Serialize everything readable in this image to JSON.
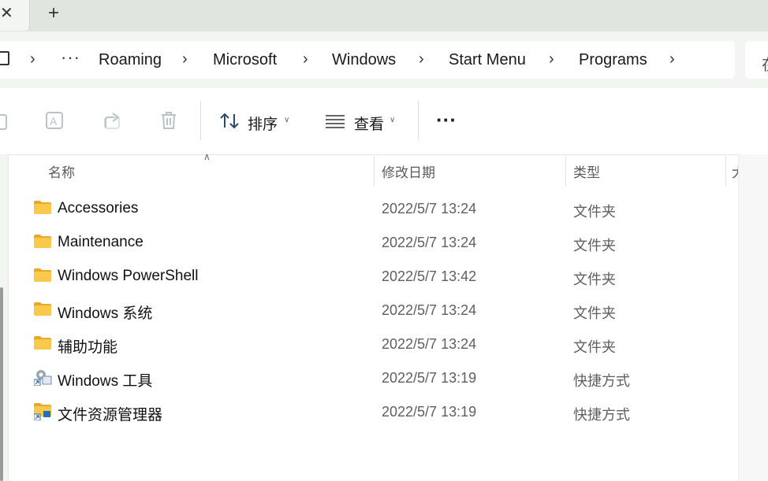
{
  "tabs": {
    "close_glyph": "✕",
    "new_tab_glyph": "+"
  },
  "breadcrumb": {
    "overflow": "···",
    "items": [
      {
        "label": "Roaming"
      },
      {
        "label": "Microsoft"
      },
      {
        "label": "Windows"
      },
      {
        "label": "Start Menu"
      },
      {
        "label": "Programs"
      }
    ],
    "separator": "›"
  },
  "search": {
    "partial_text": "在"
  },
  "toolbar": {
    "sort_label": "排序",
    "view_label": "查看",
    "more_label": "···",
    "icons": [
      "copy-icon",
      "rename-icon",
      "share-icon",
      "delete-icon",
      "sort-icon",
      "view-icon"
    ]
  },
  "columns": {
    "name": "名称",
    "date": "修改日期",
    "type": "类型",
    "size": "大"
  },
  "files": [
    {
      "name": "Accessories",
      "date": "2022/5/7 13:24",
      "type": "文件夹",
      "icon": "folder-icon"
    },
    {
      "name": "Maintenance",
      "date": "2022/5/7 13:24",
      "type": "文件夹",
      "icon": "folder-icon"
    },
    {
      "name": "Windows PowerShell",
      "date": "2022/5/7 13:42",
      "type": "文件夹",
      "icon": "folder-icon"
    },
    {
      "name": "Windows 系统",
      "date": "2022/5/7 13:24",
      "type": "文件夹",
      "icon": "folder-icon"
    },
    {
      "name": "辅助功能",
      "date": "2022/5/7 13:24",
      "type": "文件夹",
      "icon": "folder-icon"
    },
    {
      "name": "Windows 工具",
      "date": "2022/5/7 13:19",
      "type": "快捷方式",
      "icon": "tools-shortcut-icon"
    },
    {
      "name": "文件资源管理器",
      "date": "2022/5/7 13:19",
      "type": "快捷方式",
      "icon": "explorer-shortcut-icon"
    }
  ],
  "colors": {
    "folder": "#f6c343",
    "accent": "#0067c0",
    "tab_strip": "#dfe6de"
  }
}
